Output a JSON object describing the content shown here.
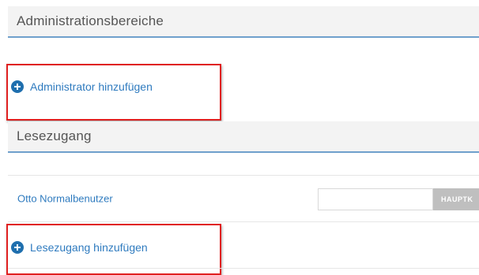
{
  "admin_section": {
    "title": "Administrationsbereiche"
  },
  "admin_add": {
    "label": "Administrator hinzufügen",
    "icon": "plus-circle-icon"
  },
  "read_section": {
    "title": "Lesezugang"
  },
  "read_users": [
    {
      "name": "Otto Normalbenutzer",
      "input_value": "",
      "button_label": "HAUPTK"
    }
  ],
  "read_add": {
    "label": "Lesezugang hinzufügen",
    "icon": "plus-circle-icon"
  },
  "colors": {
    "link": "#2f7bbf",
    "icon": "#1f6fae",
    "highlight": "#e02020",
    "header_line": "#6fa0cc"
  }
}
